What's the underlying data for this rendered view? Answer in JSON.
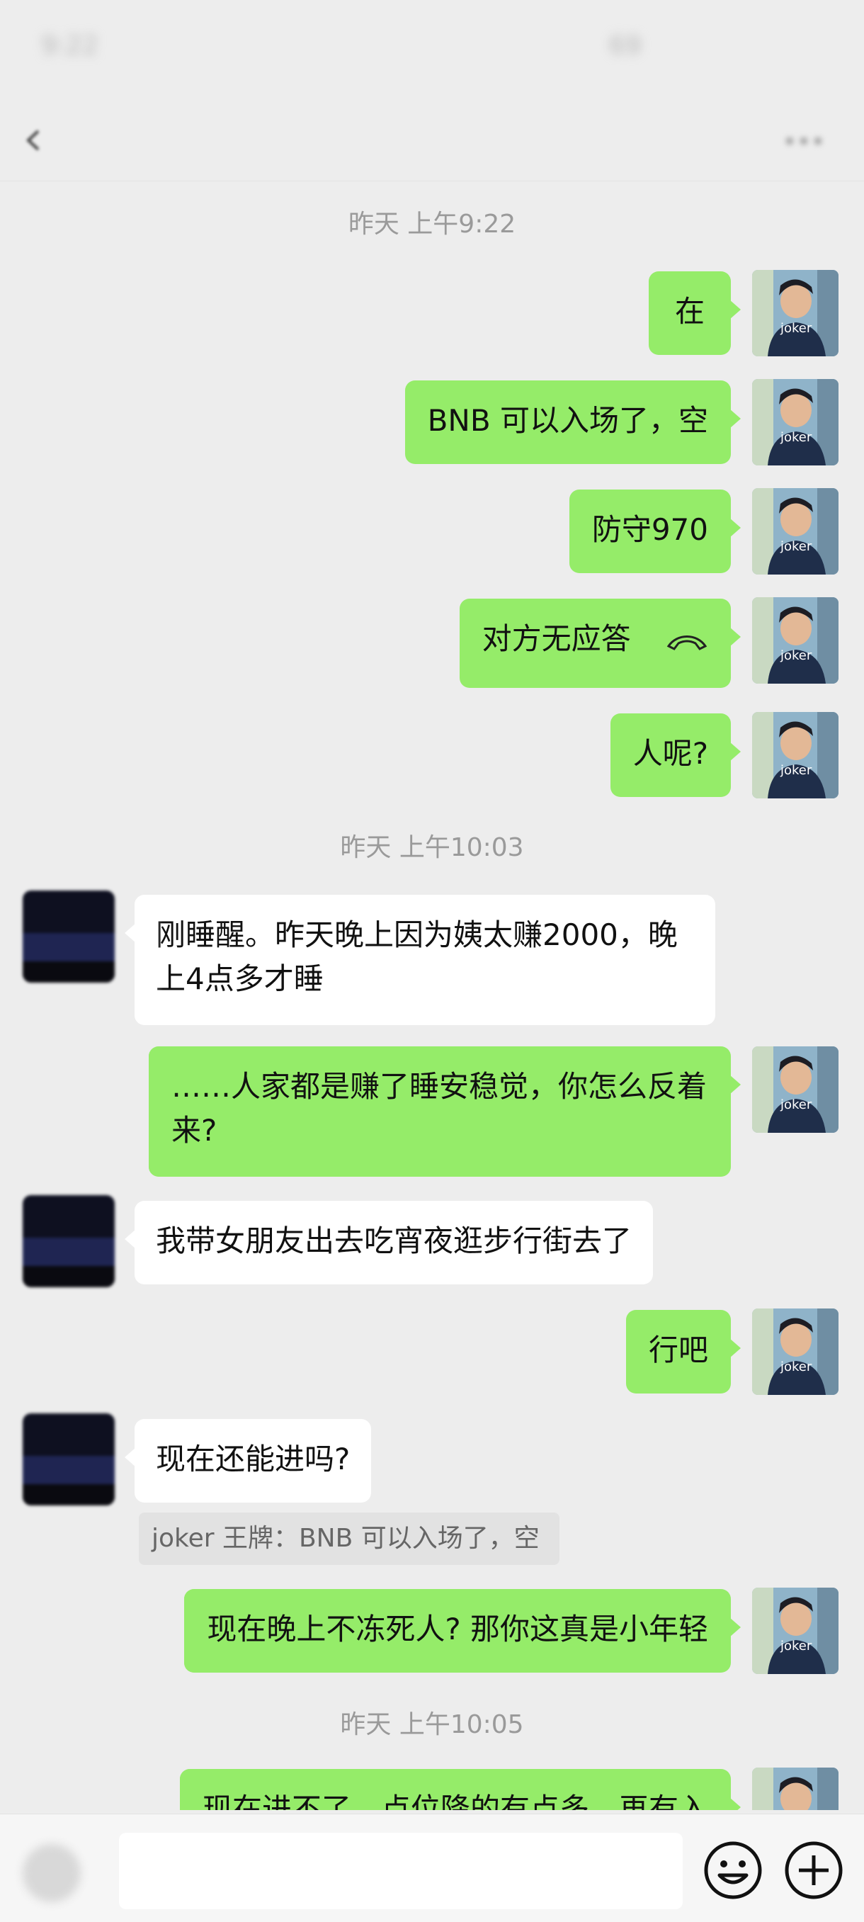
{
  "colors": {
    "background": "#ededed",
    "my_bubble": "#95ec69",
    "their_bubble": "#ffffff",
    "timestamp": "#9a9a9a"
  },
  "status_bar": {
    "time": "9:22",
    "indicators": "69"
  },
  "nav": {
    "title": "",
    "back_icon": "chevron-left-icon",
    "more_icon": "more-icon"
  },
  "timestamps": [
    "昨天 上午9:22",
    "昨天 上午10:03",
    "昨天 上午10:05"
  ],
  "messages": [
    {
      "from": "me",
      "text": "在"
    },
    {
      "from": "me",
      "text": "BNB 可以入场了，空"
    },
    {
      "from": "me",
      "text": "防守970"
    },
    {
      "from": "me",
      "text": "对方无应答",
      "icon": "phone-hangup-icon"
    },
    {
      "from": "me",
      "text": "人呢?"
    },
    {
      "from": "other",
      "text": "刚睡醒。昨天晚上因为姨太赚2000，晚上4点多才睡"
    },
    {
      "from": "me",
      "text": "……人家都是赚了睡安稳觉，你怎么反着来?"
    },
    {
      "from": "other",
      "text": "我带女朋友出去吃宵夜逛步行街去了"
    },
    {
      "from": "me",
      "text": "行吧"
    },
    {
      "from": "other",
      "text": "现在还能进吗?"
    },
    {
      "from": "me",
      "text": "现在晚上不冻死人? 那你这真是小年轻"
    },
    {
      "from": "me",
      "text": "现在进不了，点位降的有点多，再有入"
    }
  ],
  "quote": {
    "text": "joker 王牌：BNB 可以入场了，空"
  },
  "avatar_me_label": "joker",
  "input_bar": {
    "voice_icon": "voice-icon",
    "emoji_icon": "emoji-icon",
    "plus_icon": "plus-icon"
  }
}
